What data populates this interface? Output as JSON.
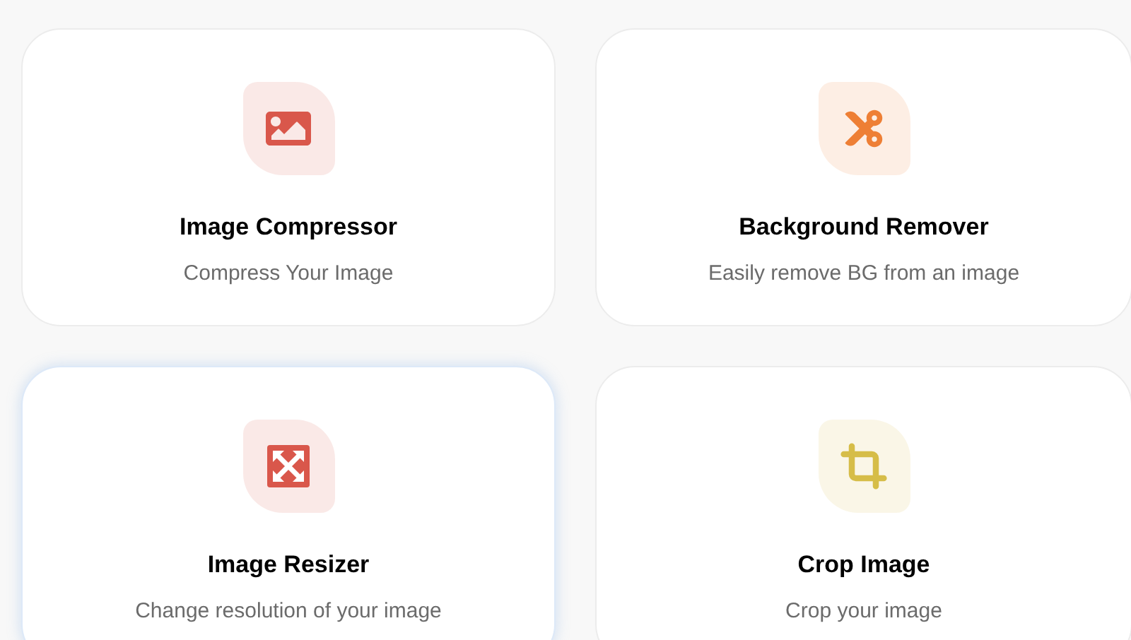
{
  "tools": [
    {
      "kind": "image",
      "color": "#d9574b",
      "title": "Image Compressor",
      "subtitle": "Compress Your Image",
      "hovered": false
    },
    {
      "kind": "scissors",
      "color": "#ee7f35",
      "title": "Background Remover",
      "subtitle": "Easily remove BG from an image",
      "hovered": false
    },
    {
      "kind": "resize",
      "color": "#d9574b",
      "title": "Image Resizer",
      "subtitle": "Change resolution of your image",
      "hovered": true
    },
    {
      "kind": "crop",
      "color": "#d6bd48",
      "title": "Crop Image",
      "subtitle": "Crop your image",
      "hovered": false
    }
  ]
}
